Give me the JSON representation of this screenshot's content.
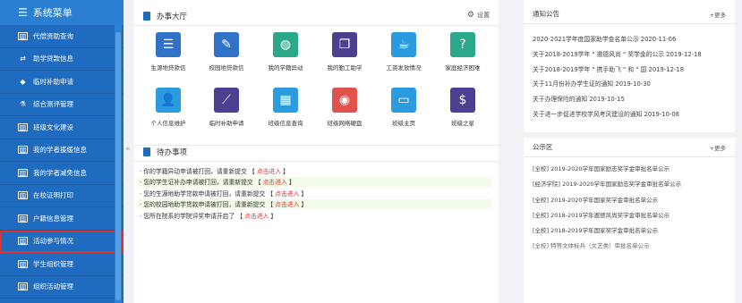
{
  "sidebar": {
    "title": "系统菜单",
    "items": [
      {
        "label": "代偿资助查询",
        "icon": "chart-box-icon"
      },
      {
        "label": "助学贷款信息",
        "icon": "exchange-icon"
      },
      {
        "label": "临时补助申请",
        "icon": "tag-icon"
      },
      {
        "label": "综合测评管理",
        "icon": "flask-icon"
      },
      {
        "label": "班级文化建设",
        "icon": "chart-box-icon"
      },
      {
        "label": "我的学者援缓信息",
        "icon": "chart-box-icon"
      },
      {
        "label": "我的学者减免信息",
        "icon": "chart-box-icon"
      },
      {
        "label": "在校证明打印",
        "icon": "chart-box-icon"
      },
      {
        "label": "户籍信息管理",
        "icon": "chart-box-icon"
      },
      {
        "label": "活动参与情况",
        "icon": "chart-box-icon"
      },
      {
        "label": "学生组织管理",
        "icon": "chart-box-icon"
      },
      {
        "label": "组织活动管理",
        "icon": "chart-box-icon"
      }
    ],
    "active_index": 9,
    "collapse_glyph": "«"
  },
  "main": {
    "title": "办事大厅",
    "settings_label": "设置",
    "tiles": [
      {
        "label": "生源地贷款信",
        "icon": "document-list-icon",
        "color": "#2f72c8"
      },
      {
        "label": "校园地贷款信",
        "icon": "pen-edit-icon",
        "color": "#2f72c8"
      },
      {
        "label": "我的学籍异动",
        "icon": "wechat-circle-icon",
        "color": "#2ba889"
      },
      {
        "label": "我的勤工助学",
        "icon": "book-icon",
        "color": "#4b3f8f"
      },
      {
        "label": "工资发放情况",
        "icon": "coffee-cup-icon",
        "color": "#2b9be0"
      },
      {
        "label": "家庭经济困难",
        "icon": "question-head-icon",
        "color": "#2ba889"
      },
      {
        "label": "个人信息维护",
        "icon": "user-icon",
        "color": "#2b9be0"
      },
      {
        "label": "临时补助申请",
        "icon": "line-chart-icon",
        "color": "#4b3f8f"
      },
      {
        "label": "班级信息查询",
        "icon": "calculator-icon",
        "color": "#2b9be0"
      },
      {
        "label": "班级网络硬盘",
        "icon": "eye-icon",
        "color": "#e0524c"
      },
      {
        "label": "班级主页",
        "icon": "window-icon",
        "color": "#2b9be0"
      },
      {
        "label": "班级之星",
        "icon": "money-bag-icon",
        "color": "#4b3f8f"
      }
    ]
  },
  "todo": {
    "title": "待办事项",
    "items": [
      {
        "text": "· 你的学籍异动申请被打回，请重新提交 【",
        "link": "点击进入",
        "end": "】",
        "hl": false
      },
      {
        "text": "· 您的学生证补办申请被打回，请重新提交 【",
        "link": "点击进入",
        "end": "】",
        "hl": true
      },
      {
        "text": "· 您的生源地助学贷款申请被打回，请重新提交 【",
        "link": "点击进入",
        "end": "】",
        "hl": false
      },
      {
        "text": "· 您的校园地助学贷款申请被打回，请重新提交 【",
        "link": "点击进入",
        "end": "】",
        "hl": true
      },
      {
        "text": "· 您所在院系的学院评奖申请开启了 【",
        "link": "点击进入",
        "end": "】",
        "hl": false
      }
    ]
  },
  "notices": {
    "title": "通知公告",
    "more": "+更多",
    "items": [
      "2020-2021学年度国家助学金名单公示 2020-11-06",
      "关于2018-2019学年 \" 邀德风尚 \" 奖学金的公示 2019-12-18",
      "关于2018-2019学年 \" 携手助飞 \" 和 \" 国 2019-12-18",
      "关于11月份补办学生证的通知 2019-10-30",
      "关于办理保险的通知 2019-10-15",
      "关于进一步促进学校学风考风建设的通知 2019-10-08"
    ]
  },
  "public": {
    "title": "公示区",
    "more": "+更多",
    "items": [
      "[全校] 2019-2020学年国家励志奖学金审批名单公示",
      "[经济学院] 2019-2020学年国家励志奖学金审批名单公示",
      "[全校] 2019-2020学年国家奖学金审批名单公示",
      "[全校] 2018-2019学年邀德风尚奖学金审批名单公示",
      "[全校] 2018-2019学年国家奖学金审批名单公示",
      "[全校] 特等文体标兵（文艺类）审批名单公示"
    ]
  }
}
